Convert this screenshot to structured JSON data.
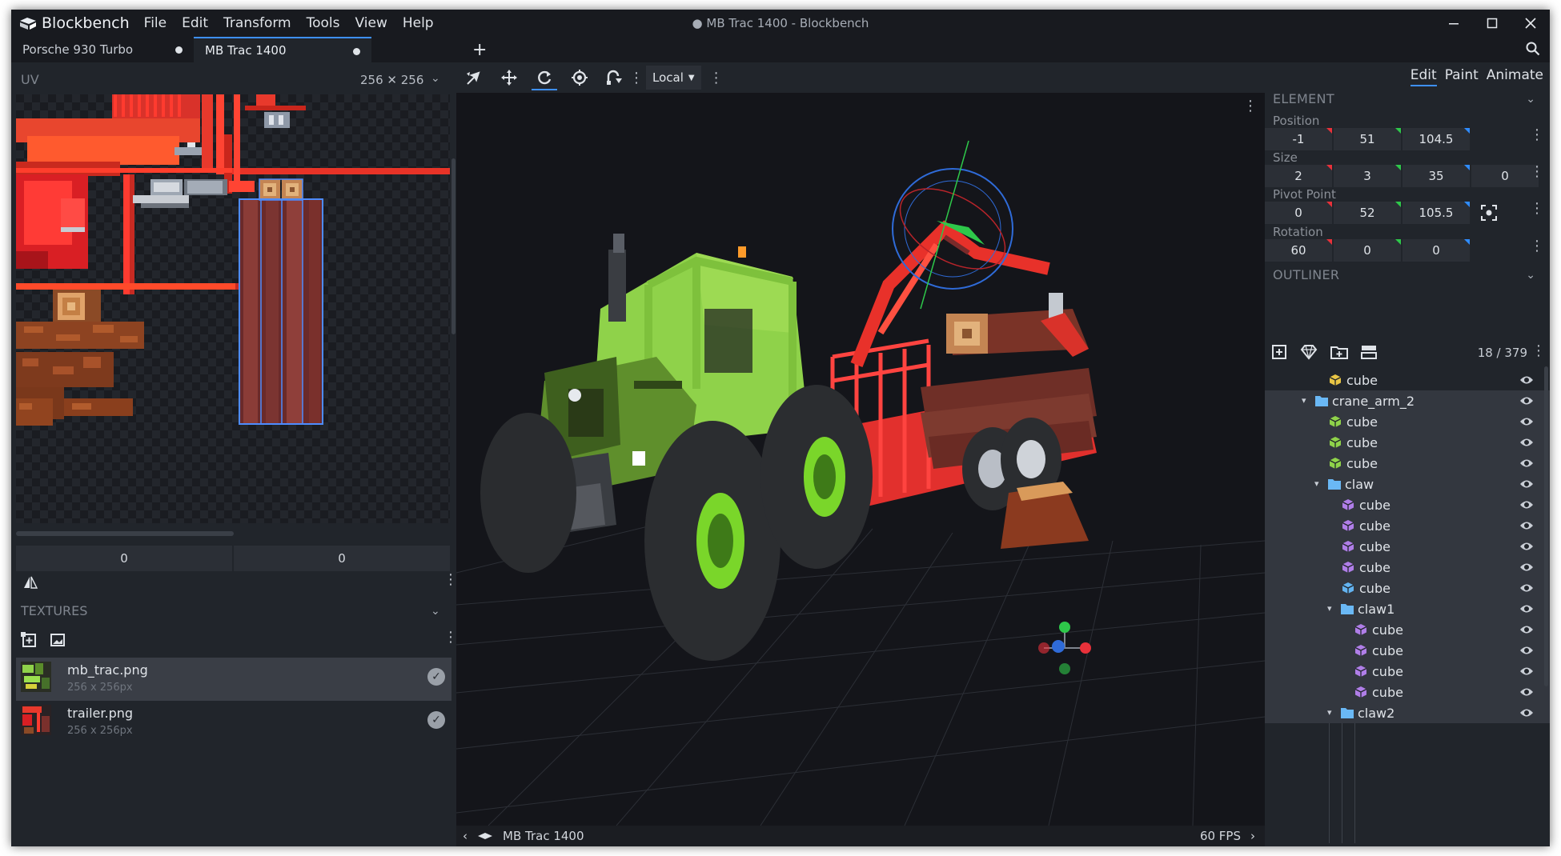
{
  "app": {
    "name": "Blockbench",
    "window_title": "● MB Trac 1400 - Blockbench",
    "menu": [
      "File",
      "Edit",
      "Transform",
      "Tools",
      "View",
      "Help"
    ],
    "colors": {
      "accent": "#3e90ff",
      "bg": "#21252b",
      "dark": "#181a1f"
    }
  },
  "tabs": [
    {
      "label": "Porsche 930 Turbo",
      "active": false,
      "unsaved": true
    },
    {
      "label": "MB Trac 1400",
      "active": true,
      "unsaved": true
    }
  ],
  "uv": {
    "title": "UV",
    "size": "256 ✕ 256",
    "field_x": "0",
    "field_y": "0"
  },
  "textures": {
    "title": "TEXTURES",
    "items": [
      {
        "name": "mb_trac.png",
        "dims": "256 x 256px",
        "selected": true
      },
      {
        "name": "trailer.png",
        "dims": "256 x 256px",
        "selected": false
      }
    ]
  },
  "toolbar": {
    "tools": [
      "move-tool-icon",
      "resize-tool-icon",
      "rotate-tool-icon",
      "pivot-tool-icon",
      "vertex-snap-icon"
    ],
    "space": "Local"
  },
  "statusbar": {
    "model": "MB Trac 1400",
    "fps": "60 FPS"
  },
  "modes": [
    "Edit",
    "Paint",
    "Animate"
  ],
  "element": {
    "title": "ELEMENT",
    "position_label": "Position",
    "position": [
      "-1",
      "51",
      "104.5"
    ],
    "size_label": "Size",
    "size": [
      "2",
      "3",
      "35",
      "0"
    ],
    "pivot_label": "Pivot Point",
    "pivot": [
      "0",
      "52",
      "105.5"
    ],
    "rotation_label": "Rotation",
    "rotation": [
      "60",
      "0",
      "0"
    ]
  },
  "outliner": {
    "title": "OUTLINER",
    "count": "18 / 379",
    "items": [
      {
        "label": "cube",
        "type": "cube",
        "depth": 4,
        "color": "#e8c545"
      },
      {
        "label": "crane_arm_2",
        "type": "group",
        "depth": 3
      },
      {
        "label": "cube",
        "type": "cube",
        "depth": 4,
        "color": "#8fd24a"
      },
      {
        "label": "cube",
        "type": "cube",
        "depth": 4,
        "color": "#8fd24a"
      },
      {
        "label": "cube",
        "type": "cube",
        "depth": 4,
        "color": "#8fd24a"
      },
      {
        "label": "claw",
        "type": "group",
        "depth": 4
      },
      {
        "label": "cube",
        "type": "cube",
        "depth": 5,
        "color": "#b07ee8"
      },
      {
        "label": "cube",
        "type": "cube",
        "depth": 5,
        "color": "#b07ee8"
      },
      {
        "label": "cube",
        "type": "cube",
        "depth": 5,
        "color": "#b07ee8"
      },
      {
        "label": "cube",
        "type": "cube",
        "depth": 5,
        "color": "#b07ee8"
      },
      {
        "label": "cube",
        "type": "cube",
        "depth": 5,
        "color": "#63b3f0"
      },
      {
        "label": "claw1",
        "type": "group",
        "depth": 5
      },
      {
        "label": "cube",
        "type": "cube",
        "depth": 6,
        "color": "#b07ee8"
      },
      {
        "label": "cube",
        "type": "cube",
        "depth": 6,
        "color": "#b07ee8"
      },
      {
        "label": "cube",
        "type": "cube",
        "depth": 6,
        "color": "#b07ee8"
      },
      {
        "label": "cube",
        "type": "cube",
        "depth": 6,
        "color": "#b07ee8"
      },
      {
        "label": "claw2",
        "type": "group",
        "depth": 5
      }
    ]
  }
}
